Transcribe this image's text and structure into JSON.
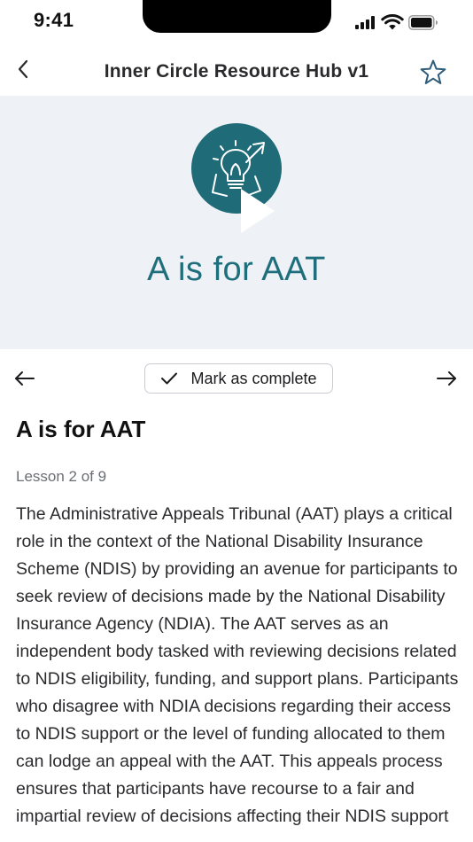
{
  "status_bar": {
    "time": "9:41"
  },
  "nav": {
    "title": "Inner Circle Resource Hub v1"
  },
  "hero": {
    "title": "A is for AAT",
    "accent_color": "#1f6b78"
  },
  "lesson_nav": {
    "complete_label": "Mark as complete"
  },
  "content": {
    "title": "A is for AAT",
    "lesson_count": "Lesson 2 of 9",
    "body": "The Administrative Appeals Tribunal (AAT) plays a critical role in the context of the National Disability Insurance Scheme (NDIS) by providing an avenue for participants to seek review of decisions made by the National Disability Insurance Agency (NDIA). The AAT serves as an independent body tasked with reviewing decisions related to NDIS eligibility, funding, and support plans. Participants who disagree with NDIA decisions regarding their access to NDIS support or the level of funding allocated to them can lodge an appeal with the AAT. This appeals process ensures that participants have recourse to a fair and impartial review of decisions affecting their NDIS support"
  },
  "icons": {
    "back": "chevron-left-icon",
    "favorite": "star-icon",
    "lesson_image": "lightbulb-icon",
    "play": "play-icon",
    "prev": "arrow-left-icon",
    "next": "arrow-right-icon",
    "check": "checkmark-icon"
  }
}
